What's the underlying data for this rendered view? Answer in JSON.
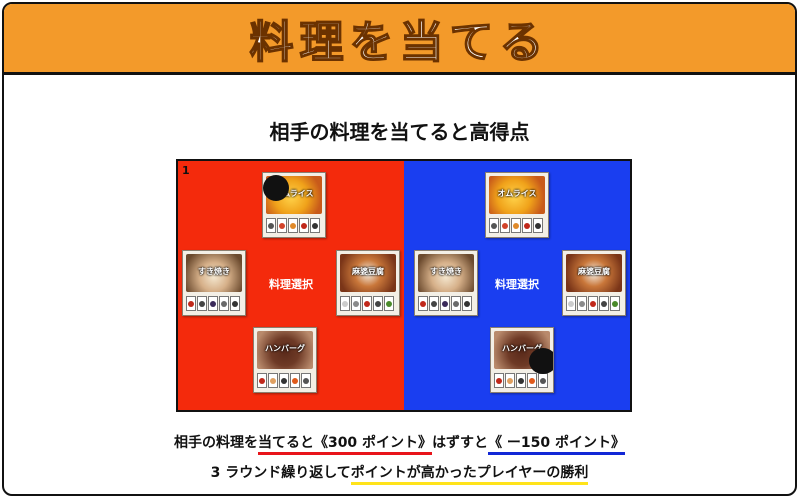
{
  "header": {
    "title": "料理を当てる"
  },
  "subtitle": "相手の料理を当てると高得点",
  "board": {
    "round_marker": "1",
    "left_panel": {
      "center_label": "料理選択",
      "cards": [
        {
          "name": "オムライス",
          "image": "omurice"
        },
        {
          "name": "すき焼き",
          "image": "sukiyaki"
        },
        {
          "name": "麻婆豆腐",
          "image": "mabo"
        },
        {
          "name": "ハンバーグ",
          "image": "hamburg"
        }
      ]
    },
    "right_panel": {
      "center_label": "料理選択",
      "cards": [
        {
          "name": "オムライス",
          "image": "omurice"
        },
        {
          "name": "すき焼き",
          "image": "sukiyaki"
        },
        {
          "name": "麻婆豆腐",
          "image": "mabo"
        },
        {
          "name": "ハンバーグ",
          "image": "hamburg"
        }
      ]
    },
    "colors": {
      "left": "#f42a0c",
      "right": "#1a3ef0"
    }
  },
  "rules": {
    "line1": {
      "part1": "相手の料理を",
      "part2": "当てると《300 ポイント》",
      "part3": "はずすと",
      "part4": "《 ー150 ポイント》"
    },
    "line2": {
      "part1": "3 ラウンド繰り返して",
      "part2": "ポイントが高かったプレイヤーの勝利"
    }
  },
  "accent_colors": {
    "header": "#f39a2a",
    "underline_red": "#e8141a",
    "underline_blue": "#1227d6",
    "underline_yellow": "#ffe31a"
  }
}
